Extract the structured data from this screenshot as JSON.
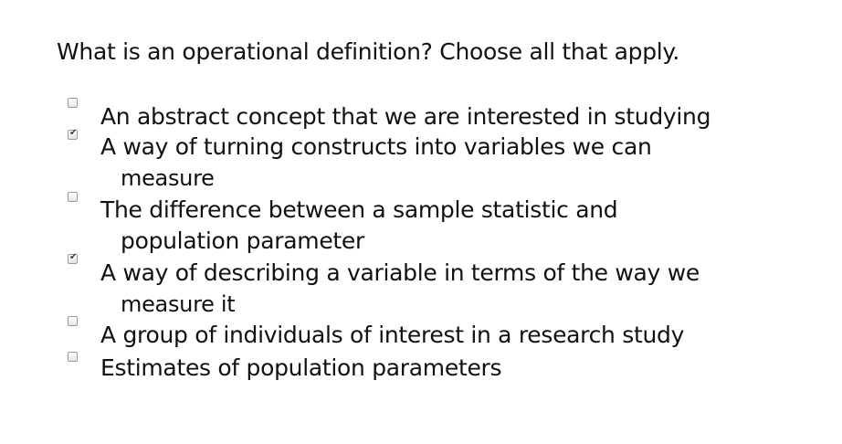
{
  "question": "What is an operational definition? Choose all that apply.",
  "options": [
    {
      "lines": [
        "An abstract concept that we are interested in studying"
      ],
      "checked": false
    },
    {
      "lines": [
        "A way of turning constructs into variables we can",
        "measure"
      ],
      "checked": true
    },
    {
      "lines": [
        "The difference between a sample statistic and",
        "population parameter"
      ],
      "checked": false
    },
    {
      "lines": [
        "A way of describing a variable in terms of the way we",
        "measure it"
      ],
      "checked": true
    },
    {
      "lines": [
        "A group of individuals of interest in a research study"
      ],
      "checked": false
    },
    {
      "lines": [
        "Estimates of population parameters"
      ],
      "checked": false
    }
  ],
  "check_glyph": "✔"
}
